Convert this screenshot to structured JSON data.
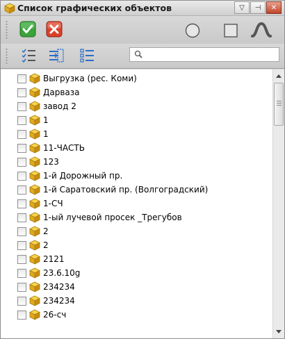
{
  "window": {
    "title": "Список графических объектов",
    "title_icon": "cube-icon",
    "buttons": [
      {
        "name": "dropdown-button",
        "glyph": "▽"
      },
      {
        "name": "pin-button",
        "glyph": "⊣"
      },
      {
        "name": "close-button",
        "glyph": "✕"
      }
    ]
  },
  "toolbar1": {
    "apply_icon": "check-icon",
    "cancel_icon": "cancel-icon",
    "circle_icon": "circle-shape-icon",
    "square_icon": "square-shape-icon",
    "curve_icon": "curve-shape-icon",
    "accent_green": "#3aa33a",
    "accent_red": "#d9412b"
  },
  "toolbar2": {
    "check_all_icon": "check-all-icon",
    "select_icon": "select-list-icon",
    "uncheck_all_icon": "uncheck-all-icon",
    "search": {
      "value": "",
      "placeholder": ""
    }
  },
  "items": [
    {
      "label": "Выгрузка (рес. Коми)",
      "checked": false
    },
    {
      "label": "Дарваза",
      "checked": false
    },
    {
      "label": "завод 2",
      "checked": false
    },
    {
      "label": "1",
      "checked": false
    },
    {
      "label": "1",
      "checked": false
    },
    {
      "label": "11-ЧАСТЬ",
      "checked": false
    },
    {
      "label": "123",
      "checked": false
    },
    {
      "label": "1-й Дорожный пр.",
      "checked": false
    },
    {
      "label": "1-й Саратовский пр. (Волгоградский)",
      "checked": false
    },
    {
      "label": " 1-СЧ",
      "checked": false
    },
    {
      "label": "1-ый лучевой просек _Трегубов",
      "checked": false
    },
    {
      "label": "2",
      "checked": false
    },
    {
      "label": "2",
      "checked": false
    },
    {
      "label": "2121",
      "checked": false
    },
    {
      "label": "23.6.10g",
      "checked": false
    },
    {
      "label": "234234",
      "checked": false
    },
    {
      "label": "234234",
      "checked": false
    },
    {
      "label": "26-сч",
      "checked": false
    }
  ]
}
